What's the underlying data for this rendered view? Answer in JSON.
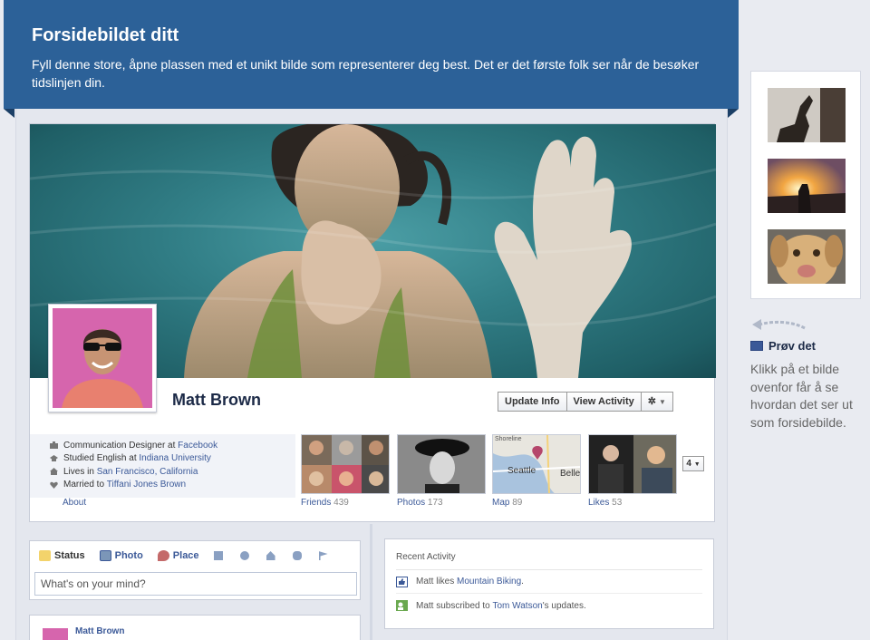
{
  "banner": {
    "title": "Forsidebildet ditt",
    "text": "Fyll denne store, åpne plassen med et unikt bilde som representerer deg best. Det er det første folk ser når de besøker tidslinjen din."
  },
  "profile": {
    "name": "Matt Brown",
    "update_info": "Update Info",
    "view_activity": "View Activity",
    "settings_icon": "gear-icon"
  },
  "info": [
    {
      "prefix": "Communication Designer at ",
      "link": "Facebook",
      "icon": "briefcase-icon"
    },
    {
      "prefix": "Studied English at ",
      "link": "Indiana University",
      "icon": "graduation-cap-icon"
    },
    {
      "prefix": "Lives in ",
      "link": "San Francisco, California",
      "icon": "house-icon"
    },
    {
      "prefix": "Married to ",
      "link": "Tiffani Jones Brown",
      "icon": "heart-icon"
    }
  ],
  "about_label": "About",
  "tiles": [
    {
      "label": "Friends",
      "count": "439"
    },
    {
      "label": "Photos",
      "count": "173"
    },
    {
      "label": "Map",
      "count": "89"
    },
    {
      "label": "Likes",
      "count": "53"
    }
  ],
  "map_labels": {
    "city1": "Seattle",
    "city2": "Belle",
    "top": "Shoreline"
  },
  "more_count": "4",
  "composer": {
    "tabs": [
      "Status",
      "Photo",
      "Place"
    ],
    "placeholder": "What's on your mind?"
  },
  "post_author": "Matt Brown",
  "recent_activity": {
    "title": "Recent Activity",
    "items": [
      {
        "prefix": "Matt likes ",
        "link": "Mountain Biking",
        "suffix": "."
      },
      {
        "prefix": "Matt subscribed to ",
        "link": "Tom Watson",
        "suffix": "'s updates."
      }
    ]
  },
  "side": {
    "title": "Prøv det",
    "text": "Klikk på et bilde ovenfor får å se hvordan det ser ut som forsidebilde."
  },
  "colors": {
    "banner": "#2c6198",
    "link": "#3b5998",
    "profile_bg": "#d665ad",
    "water": "#327f87"
  }
}
